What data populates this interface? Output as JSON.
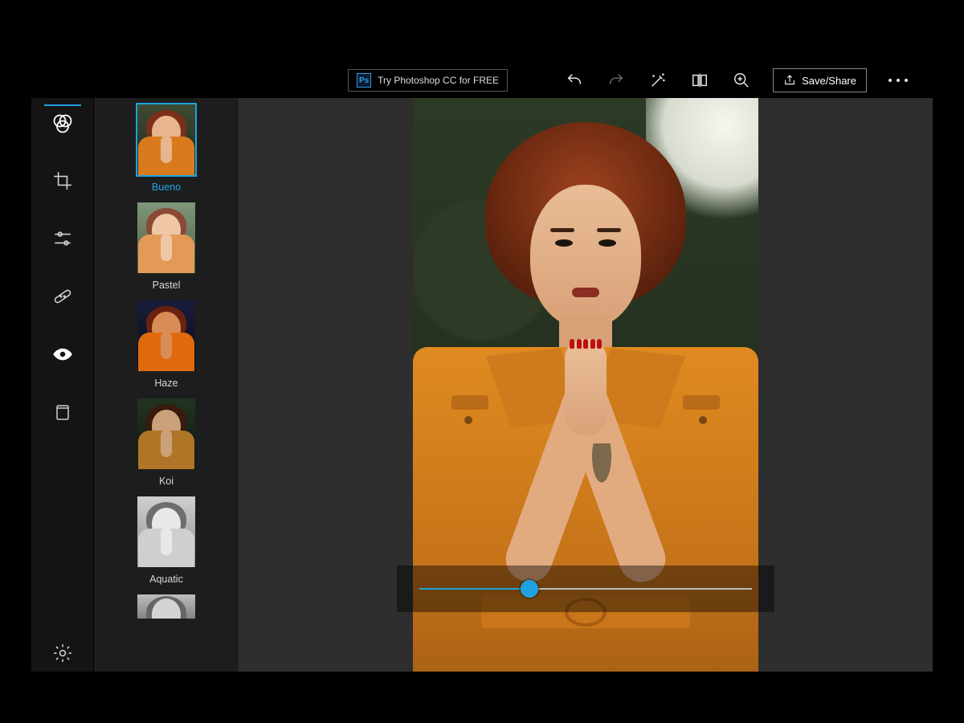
{
  "colors": {
    "accent": "#1fa3e0"
  },
  "topbar": {
    "promo": {
      "badge": "Ps",
      "label": "Try Photoshop CC for FREE"
    },
    "save_label": "Save/Share"
  },
  "tools": [
    {
      "id": "looks",
      "icon": "looks-icon"
    },
    {
      "id": "crop",
      "icon": "crop-icon"
    },
    {
      "id": "adjust",
      "icon": "sliders-icon"
    },
    {
      "id": "heal",
      "icon": "bandage-icon"
    },
    {
      "id": "redeye",
      "icon": "eye-icon"
    },
    {
      "id": "border",
      "icon": "frame-icon"
    },
    {
      "id": "settings",
      "icon": "gear-icon"
    }
  ],
  "active_tool": "looks",
  "presets": [
    {
      "id": "bueno",
      "label": "Bueno",
      "selected": true
    },
    {
      "id": "pastel",
      "label": "Pastel",
      "selected": false
    },
    {
      "id": "haze",
      "label": "Haze",
      "selected": false
    },
    {
      "id": "koi",
      "label": "Koi",
      "selected": false
    },
    {
      "id": "aquatic",
      "label": "Aquatic",
      "selected": false
    }
  ],
  "slider": {
    "value": 33,
    "min": 0,
    "max": 100
  }
}
